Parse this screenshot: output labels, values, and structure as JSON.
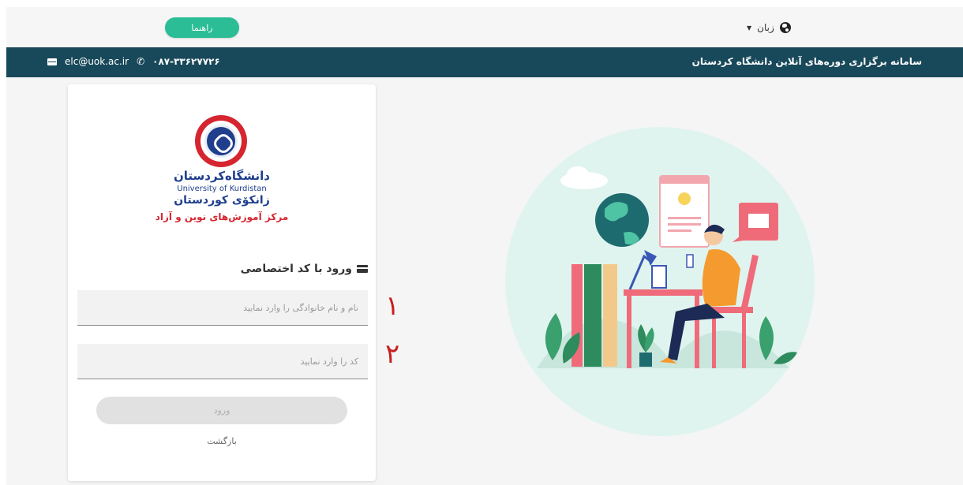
{
  "topbar": {
    "help_label": "راهنما",
    "language_label": "زبان"
  },
  "infobar": {
    "site_title": "سامانه برگزاری دوره‌های آنلاین دانشگاه کردستان",
    "email": "elc@uok.ac.ir",
    "phone": "۰۸۷-۳۳۶۲۷۷۲۶"
  },
  "logo": {
    "name_fa": "دانشگاه‌کردستان",
    "name_en": "University of Kurdistan",
    "name_ku": "زانکۆی کوردستان",
    "center_name": "مرکز آموزش‌های نوین و آزاد"
  },
  "login": {
    "heading": "ورود با کد اختصاصی",
    "name_placeholder": "نام و نام خانوادگی را وارد نمایید",
    "name_value": "",
    "code_placeholder": "کد را وارد نمایید",
    "code_value": "",
    "submit_label": "ورود",
    "back_label": "بازگشت"
  },
  "annotations": {
    "step1": "۱",
    "step2": "۲"
  },
  "colors": {
    "header_bg": "#18495a",
    "accent_green": "#2bbd96",
    "annotation_red": "#c61f1f",
    "logo_blue": "#1f3e8c",
    "logo_red": "#d52630"
  }
}
